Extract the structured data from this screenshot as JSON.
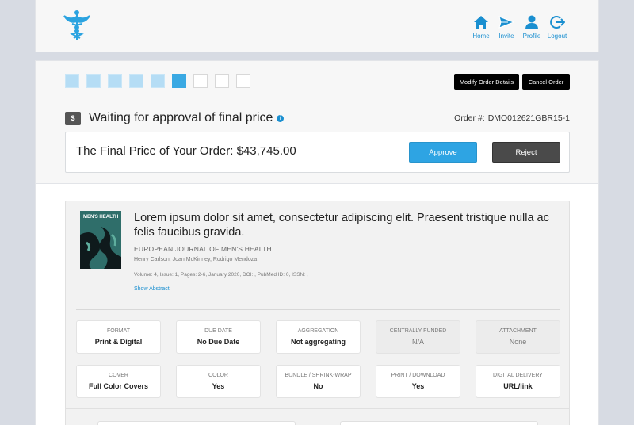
{
  "header": {
    "nav": [
      {
        "label": "Home",
        "icon": "home-icon"
      },
      {
        "label": "Invite",
        "icon": "paper-plane-icon"
      },
      {
        "label": "Profile",
        "icon": "user-icon"
      },
      {
        "label": "Logout",
        "icon": "logout-icon"
      }
    ],
    "accent_color": "#1a8fd0"
  },
  "progress": {
    "total_steps": 9,
    "completed_steps": 5,
    "current_step": 6
  },
  "actions": {
    "modify_label": "Modify Order Details",
    "cancel_label": "Cancel Order"
  },
  "status": {
    "badge": "$",
    "text": "Waiting for approval of final price",
    "info": "i",
    "order_label": "Order #:",
    "order_number": "DMO012621GBR15-1"
  },
  "price": {
    "text": "The Final Price of Your Order: $43,745.00",
    "approve_label": "Approve",
    "reject_label": "Reject"
  },
  "article": {
    "cover_title": "MEN'S HEALTH",
    "title": "Lorem ipsum dolor sit amet, consectetur adipiscing elit. Praesent tristique nulla ac felis faucibus gravida.",
    "journal": "EUROPEAN JOURNAL OF MEN'S HEALTH",
    "authors": "Henry Carlson, Joan McKinney, Rodrigo Mendoza",
    "meta": "Volume: 4, Issue: 1, Pages: 2-6, January 2020, DOI: , PubMed ID: 0, ISSN: ,",
    "abstract_link": "Show Abstract"
  },
  "attributes": [
    {
      "key": "FORMAT",
      "value": "Print & Digital",
      "disabled": false
    },
    {
      "key": "DUE DATE",
      "value": "No Due Date",
      "disabled": false
    },
    {
      "key": "AGGREGATION",
      "value": "Not aggregating",
      "disabled": false
    },
    {
      "key": "CENTRALLY FUNDED",
      "value": "N/A",
      "disabled": true
    },
    {
      "key": "ATTACHMENT",
      "value": "None",
      "disabled": true
    },
    {
      "key": "COVER",
      "value": "Full Color Covers",
      "disabled": false
    },
    {
      "key": "COLOR",
      "value": "Yes",
      "disabled": false
    },
    {
      "key": "BUNDLE / SHRINK-WRAP",
      "value": "No",
      "disabled": false
    },
    {
      "key": "PRINT / DOWNLOAD",
      "value": "Yes",
      "disabled": false
    },
    {
      "key": "DIGITAL DELIVERY",
      "value": "URL/link",
      "disabled": false
    }
  ]
}
